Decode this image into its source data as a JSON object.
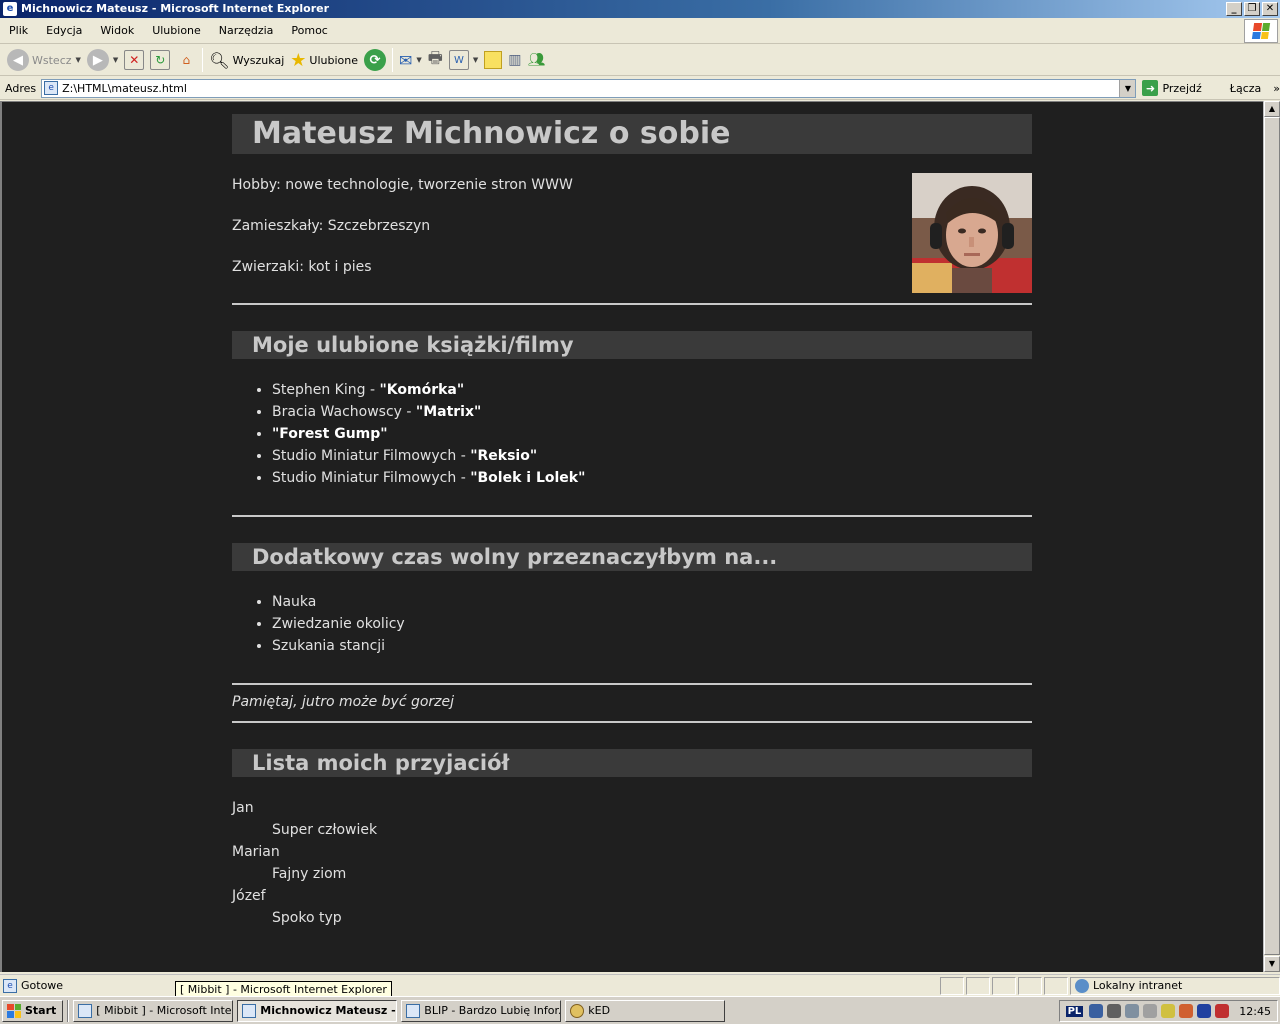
{
  "window": {
    "title": "Michnowicz Mateusz - Microsoft Internet Explorer"
  },
  "menu": {
    "items": [
      "Plik",
      "Edycja",
      "Widok",
      "Ulubione",
      "Narzędzia",
      "Pomoc"
    ]
  },
  "toolbar": {
    "back_label": "Wstecz",
    "search_label": "Wyszukaj",
    "favorites_label": "Ulubione"
  },
  "address": {
    "label": "Adres",
    "url": "Z:\\HTML\\mateusz.html",
    "go_label": "Przejdź",
    "links_label": "Łącza"
  },
  "page": {
    "title": "Mateusz Michnowicz o sobie",
    "info": [
      "Hobby: nowe technologie, tworzenie stron WWW",
      "Zamieszkały: Szczebrzeszyn",
      "Zwierzaki: kot i pies"
    ],
    "books_heading": "Moje ulubione książki/filmy",
    "books": [
      {
        "prefix": "Stephen King - ",
        "title": "\"Komórka\""
      },
      {
        "prefix": "Bracia Wachowscy - ",
        "title": "\"Matrix\""
      },
      {
        "prefix": "",
        "title": "\"Forest Gump\""
      },
      {
        "prefix": "Studio Miniatur Filmowych - ",
        "title": "\"Reksio\""
      },
      {
        "prefix": "Studio Miniatur Filmowych - ",
        "title": "\"Bolek i Lolek\""
      }
    ],
    "free_time_heading": "Dodatkowy czas wolny przeznaczyłbym na...",
    "free_time": [
      "Nauka",
      "Zwiedzanie okolicy",
      "Szukania stancji"
    ],
    "quote": "Pamiętaj, jutro może być gorzej",
    "friends_heading": "Lista moich przyjaciół",
    "friends": [
      {
        "name": "Jan",
        "desc": "Super człowiek"
      },
      {
        "name": "Marian",
        "desc": "Fajny ziom"
      },
      {
        "name": "Józef",
        "desc": "Spoko typ"
      }
    ]
  },
  "status": {
    "text": "Gotowe",
    "zone": "Lokalny intranet",
    "tooltip": "[ Mibbit ] - Microsoft Internet Explorer"
  },
  "taskbar": {
    "start_label": "Start",
    "tasks": [
      "[ Mibbit ] - Microsoft Inte...",
      "Michnowicz Mateusz -...",
      "BLIP - Bardzo Lubię Infor...",
      "kED"
    ],
    "lang": "PL",
    "clock": "12:45"
  },
  "colors": {
    "page_bg": "#1f1f1f",
    "heading_bg": "#3a3a3a",
    "heading_text": "#c8c8c8",
    "body_text": "#e0e0e0"
  }
}
